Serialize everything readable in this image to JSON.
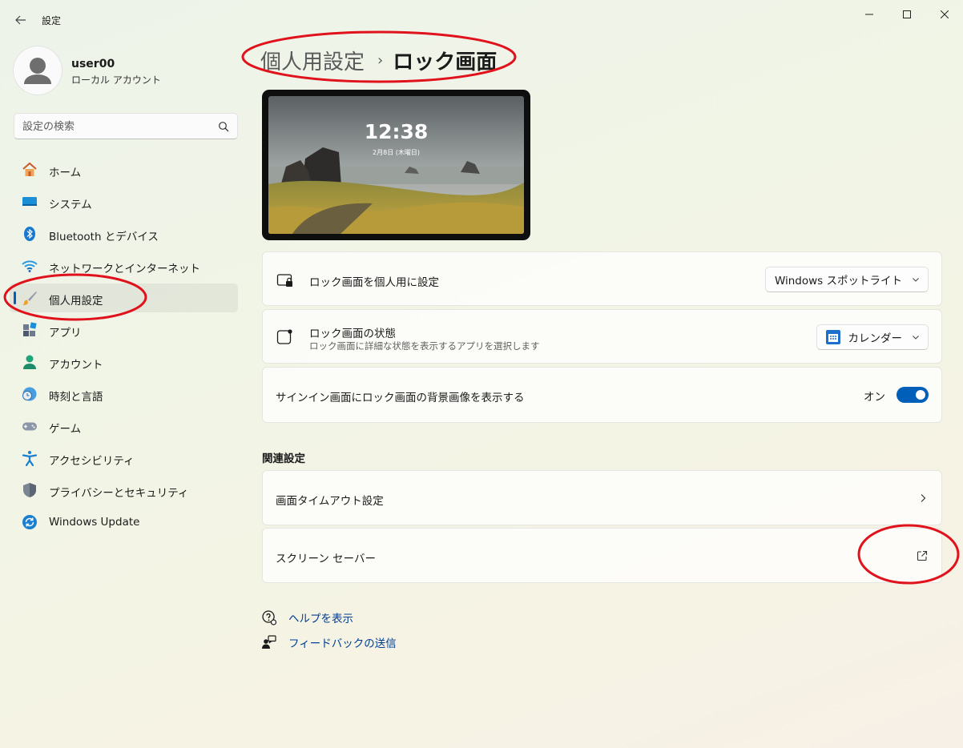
{
  "window": {
    "title": "設定",
    "back_icon": "back-arrow-icon",
    "controls": [
      "minimize-icon",
      "maximize-icon",
      "close-icon"
    ]
  },
  "user": {
    "name": "user00",
    "type": "ローカル アカウント"
  },
  "search": {
    "placeholder": "設定の検索"
  },
  "sidebar": {
    "items": [
      {
        "label": "ホーム",
        "icon": "home-icon"
      },
      {
        "label": "システム",
        "icon": "system-icon"
      },
      {
        "label": "Bluetooth とデバイス",
        "icon": "bluetooth-icon"
      },
      {
        "label": "ネットワークとインターネット",
        "icon": "wifi-icon"
      },
      {
        "label": "個人用設定",
        "icon": "brush-icon",
        "selected": true
      },
      {
        "label": "アプリ",
        "icon": "apps-icon"
      },
      {
        "label": "アカウント",
        "icon": "account-icon"
      },
      {
        "label": "時刻と言語",
        "icon": "clock-globe-icon"
      },
      {
        "label": "ゲーム",
        "icon": "gamepad-icon"
      },
      {
        "label": "アクセシビリティ",
        "icon": "accessibility-icon"
      },
      {
        "label": "プライバシーとセキュリティ",
        "icon": "shield-icon"
      },
      {
        "label": "Windows Update",
        "icon": "update-icon"
      }
    ]
  },
  "breadcrumb": {
    "parent": "個人用設定",
    "separator": "›",
    "current": "ロック画面"
  },
  "preview": {
    "time": "12:38",
    "date": "2月8日 (木曜日)"
  },
  "settings": {
    "personalize": {
      "title": "ロック画面を個人用に設定",
      "value": "Windows スポットライト"
    },
    "status": {
      "title": "ロック画面の状態",
      "subtitle": "ロック画面に詳細な状態を表示するアプリを選択します",
      "value": "カレンダー"
    },
    "signin": {
      "title": "サインイン画面にロック画面の背景画像を表示する",
      "toggle_label": "オン",
      "toggle_on": true
    }
  },
  "related": {
    "title": "関連設定",
    "items": [
      {
        "label": "画面タイムアウト設定",
        "icon": "chevron-right-icon"
      },
      {
        "label": "スクリーン セーバー",
        "icon": "external-link-icon"
      }
    ]
  },
  "links": {
    "help": "ヘルプを表示",
    "feedback": "フィードバックの送信"
  },
  "colors": {
    "accent": "#005fb8",
    "annotation": "#e0121c"
  }
}
